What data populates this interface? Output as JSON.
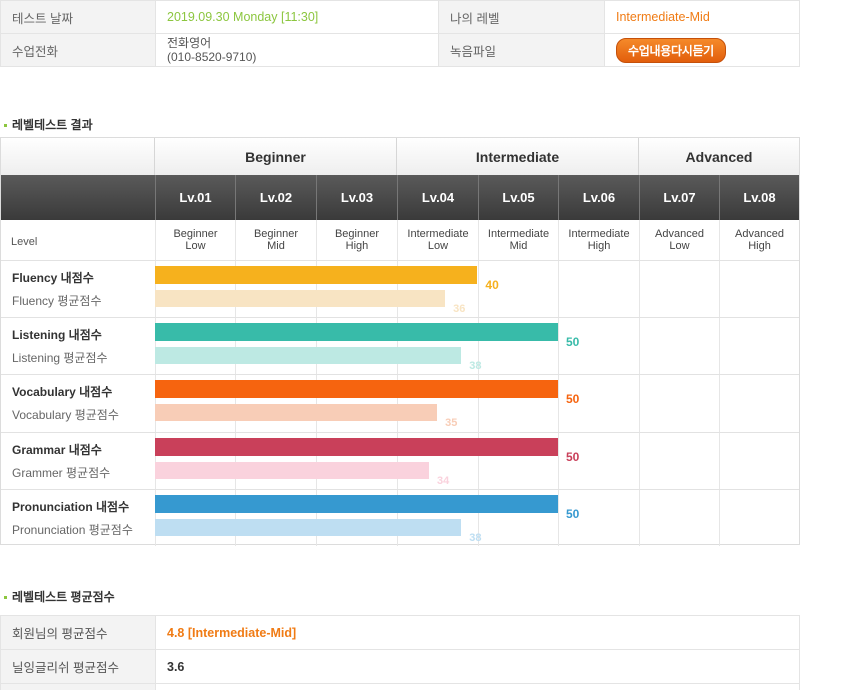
{
  "info": {
    "test_date_label": "테스트 날짜",
    "test_date_value": "2019.09.30  Monday [11:30]",
    "my_level_label": "나의 레벨",
    "my_level_value": "Intermediate-Mid",
    "class_phone_label": "수업전화",
    "class_phone_line1": "전화영어",
    "class_phone_line2": "(010-8520-9710)",
    "recording_label": "녹음파일",
    "recording_button": "수업내용다시듣기"
  },
  "result_section": {
    "title": "레벨테스트 결과",
    "groups": [
      "Beginner",
      "Intermediate",
      "Advanced"
    ],
    "levels": [
      "Lv.01",
      "Lv.02",
      "Lv.03",
      "Lv.04",
      "Lv.05",
      "Lv.06",
      "Lv.07",
      "Lv.08"
    ],
    "level_label": "Level",
    "level_desc": [
      [
        "Beginner",
        "Low"
      ],
      [
        "Beginner",
        "Mid"
      ],
      [
        "Beginner",
        "High"
      ],
      [
        "Intermediate",
        "Low"
      ],
      [
        "Intermediate",
        "Mid"
      ],
      [
        "Intermediate",
        "High"
      ],
      [
        "Advanced",
        "Low"
      ],
      [
        "Advanced",
        "High"
      ]
    ],
    "scale_max": 80,
    "skills": [
      {
        "name": "Fluency 내점수",
        "avg_name": "Fluency 평균점수",
        "my_score": 40,
        "avg_score": 36,
        "color": "#f6b11d",
        "light": "#f8e4c3"
      },
      {
        "name": "Listening 내점수",
        "avg_name": "Listening 평균점수",
        "my_score": 50,
        "avg_score": 38,
        "color": "#38bba9",
        "light": "#bde9e3"
      },
      {
        "name": "Vocabulary 내점수",
        "avg_name": "Vocabulary 평균점수",
        "my_score": 50,
        "avg_score": 35,
        "color": "#f6640f",
        "light": "#f8cdb7"
      },
      {
        "name": "Grammar 내점수",
        "avg_name": "Grammer 평균점수",
        "my_score": 50,
        "avg_score": 34,
        "color": "#c9405a",
        "light": "#fad2dd"
      },
      {
        "name": "Pronunciation 내점수",
        "avg_name": "Pronunciation 평균점수",
        "my_score": 50,
        "avg_score": 38,
        "color": "#3699d0",
        "light": "#bedef2"
      }
    ]
  },
  "avg_section": {
    "title": "레벨테스트 평균점수",
    "rows": [
      {
        "label": "회원님의 평균점수",
        "value": "4.8 [Intermediate-Mid]"
      },
      {
        "label": "닐잉글리쉬 평균점수",
        "value": "3.6"
      }
    ]
  }
}
